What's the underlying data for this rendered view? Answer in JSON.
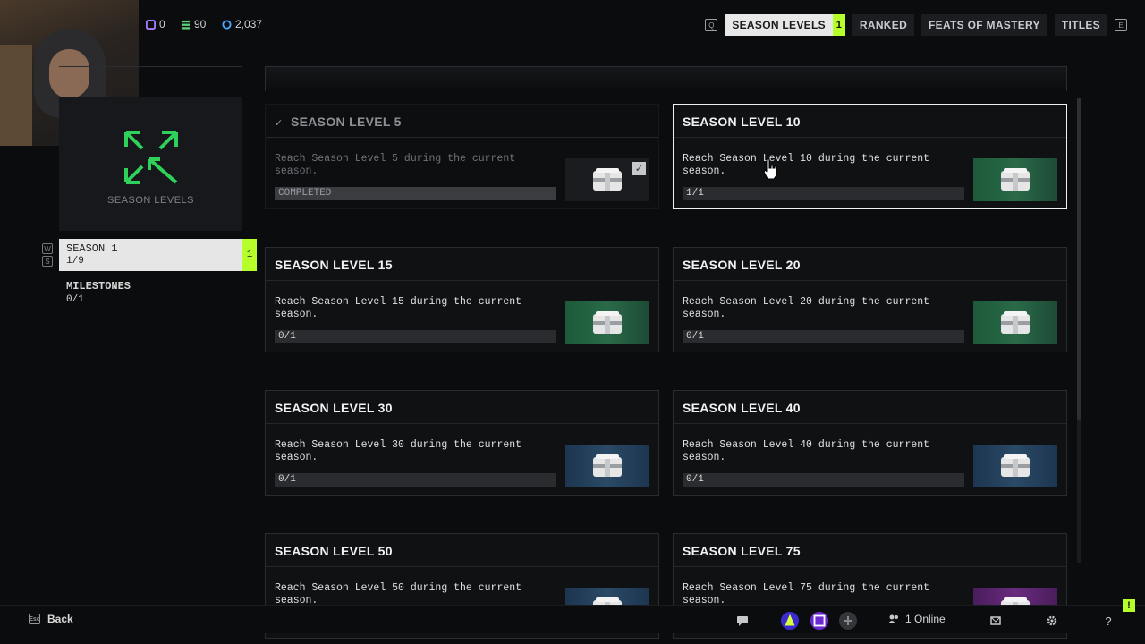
{
  "currencies": [
    {
      "icon": "purple-token-icon",
      "value": "0",
      "color": "#a77bff"
    },
    {
      "icon": "green-stack-icon",
      "value": "90",
      "color": "#5fd07a"
    },
    {
      "icon": "blue-coin-icon",
      "value": "2,037",
      "color": "#4aa8ff"
    }
  ],
  "nav": {
    "tabs": [
      {
        "label": "SEASON LEVELS",
        "badge": "1",
        "active": true
      },
      {
        "label": "RANKED"
      },
      {
        "label": "FEATS OF MASTERY"
      },
      {
        "label": "TITLES"
      }
    ],
    "left_key": "Q",
    "right_key": "E"
  },
  "sidebar": {
    "emblem_label": "SEASON LEVELS",
    "season": {
      "title": "SEASON 1",
      "progress": "1/9",
      "badge": "1"
    },
    "milestones": {
      "title": "MILESTONES",
      "progress": "0/1"
    },
    "hotkeys": [
      "W",
      "S"
    ]
  },
  "cards": [
    {
      "title": "SEASON LEVEL 5",
      "desc": "Reach Season Level 5 during the current season.",
      "progress": "COMPLETED",
      "status": "completed",
      "thumb": "plain"
    },
    {
      "title": "SEASON LEVEL 10",
      "desc": "Reach Season Level 10 during the current season.",
      "progress": "1/1",
      "status": "selected",
      "thumb": "green"
    },
    {
      "title": "SEASON LEVEL 15",
      "desc": "Reach Season Level 15 during the current season.",
      "progress": "0/1",
      "status": "",
      "thumb": "green"
    },
    {
      "title": "SEASON LEVEL 20",
      "desc": "Reach Season Level 20 during the current season.",
      "progress": "0/1",
      "status": "",
      "thumb": "green"
    },
    {
      "title": "SEASON LEVEL 30",
      "desc": "Reach Season Level 30 during the current season.",
      "progress": "0/1",
      "status": "",
      "thumb": "blue"
    },
    {
      "title": "SEASON LEVEL 40",
      "desc": "Reach Season Level 40 during the current season.",
      "progress": "0/1",
      "status": "",
      "thumb": "blue"
    },
    {
      "title": "SEASON LEVEL 50",
      "desc": "Reach Season Level 50 during the current season.",
      "progress": "",
      "status": "",
      "thumb": "blue"
    },
    {
      "title": "SEASON LEVEL 75",
      "desc": "Reach Season Level 75 during the current season.",
      "progress": "",
      "status": "",
      "thumb": "purple"
    }
  ],
  "bottom": {
    "back_label": "Back",
    "back_key": "Esc",
    "online_label": "1 Online"
  },
  "notification_badge": "!"
}
